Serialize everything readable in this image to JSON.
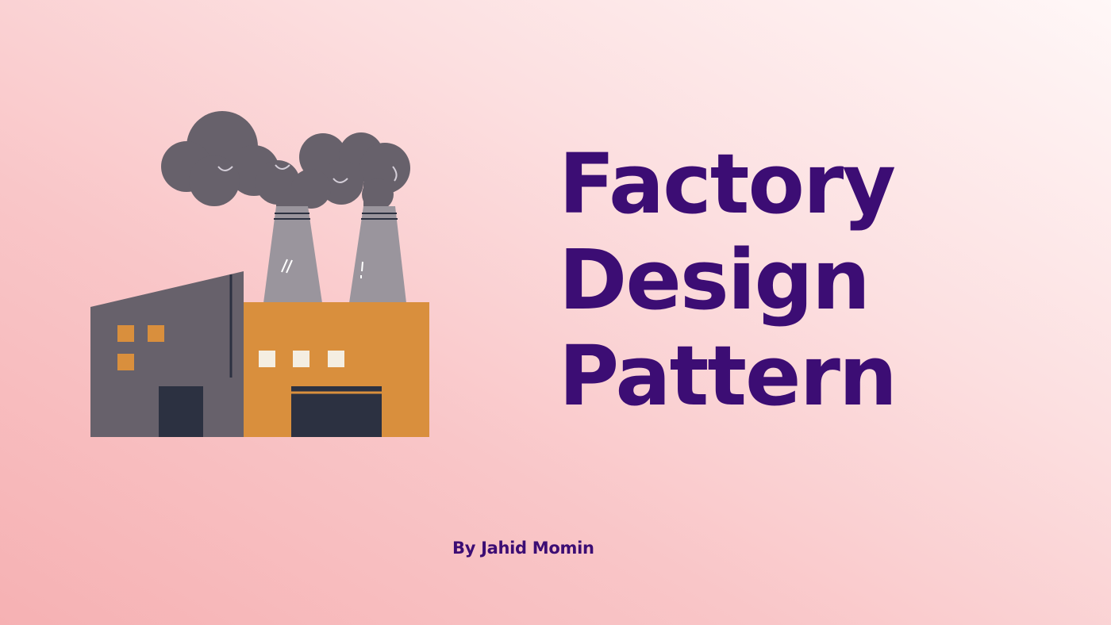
{
  "title": {
    "line1": "Factory",
    "line2": "Design",
    "line3": "Pattern"
  },
  "author": "By Jahid Momin",
  "illustration": {
    "subject": "factory-icon",
    "smoke_color": "#67616b",
    "chimney_color": "#9a959d",
    "left_building_color": "#67616b",
    "right_building_color": "#d98f3d",
    "door_color": "#2c3141",
    "window_color": "#d98f3d",
    "light_window_color": "#f4eee2"
  },
  "colors": {
    "text": "#3c0d74",
    "background_start": "#f6b1b3",
    "background_end": "#fff7f7"
  }
}
